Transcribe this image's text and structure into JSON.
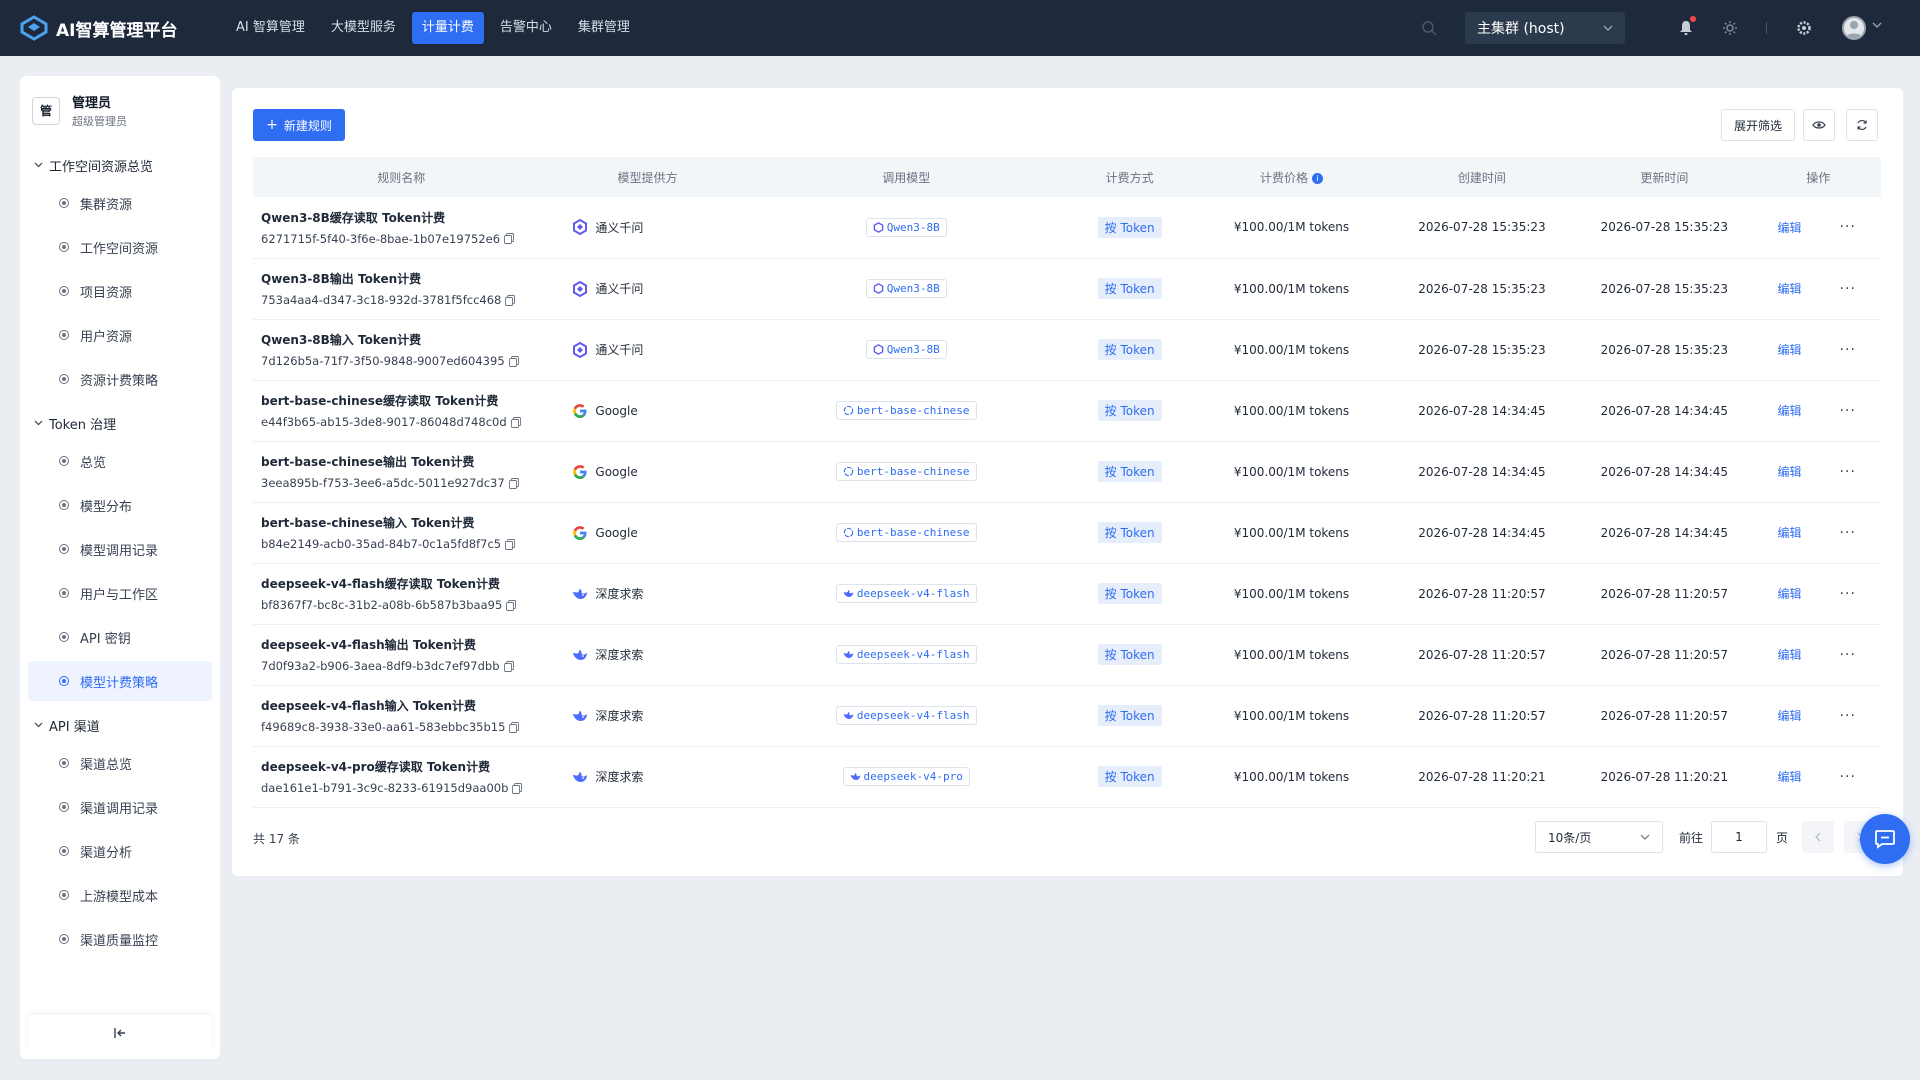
{
  "app": {
    "title": "AI智算管理平台"
  },
  "topnav": [
    {
      "label": "AI 智算管理",
      "active": false
    },
    {
      "label": "大模型服务",
      "active": false
    },
    {
      "label": "计量计费",
      "active": true
    },
    {
      "label": "告警中心",
      "active": false
    },
    {
      "label": "集群管理",
      "active": false
    }
  ],
  "cluster": {
    "selected": "主集群 (host)"
  },
  "user": {
    "avatar_char": "管",
    "name": "管理员",
    "role": "超级管理员"
  },
  "sidebar": {
    "groups": [
      {
        "label": "工作空间资源总览",
        "items": [
          {
            "label": "集群资源"
          },
          {
            "label": "工作空间资源"
          },
          {
            "label": "项目资源"
          },
          {
            "label": "用户资源"
          },
          {
            "label": "资源计费策略"
          }
        ]
      },
      {
        "label": "Token 治理",
        "items": [
          {
            "label": "总览"
          },
          {
            "label": "模型分布"
          },
          {
            "label": "模型调用记录"
          },
          {
            "label": "用户与工作区"
          },
          {
            "label": "API 密钥"
          },
          {
            "label": "模型计费策略",
            "active": true
          }
        ]
      },
      {
        "label": "API 渠道",
        "items": [
          {
            "label": "渠道总览"
          },
          {
            "label": "渠道调用记录"
          },
          {
            "label": "渠道分析"
          },
          {
            "label": "上游模型成本"
          },
          {
            "label": "渠道质量监控"
          }
        ]
      }
    ]
  },
  "toolbar": {
    "new_label": "新建规则",
    "filter_label": "展开筛选"
  },
  "table": {
    "headers": [
      "规则名称",
      "模型提供方",
      "调用模型",
      "计费方式",
      "计费价格",
      "创建时间",
      "更新时间",
      "操作"
    ],
    "edit_label": "编辑",
    "rows": [
      {
        "name": "Qwen3-8B缓存读取 Token计费",
        "id": "6271715f-5f40-3f6e-8bae-1b07e19752e6",
        "provider": "通义千问",
        "provider_icon": "qwen",
        "model": "Qwen3-8B",
        "billing": "按 Token",
        "price": "¥100.00/1M tokens",
        "created": "2026-07-28 15:35:23",
        "updated": "2026-07-28 15:35:23"
      },
      {
        "name": "Qwen3-8B输出 Token计费",
        "id": "753a4aa4-d347-3c18-932d-3781f5fcc468",
        "provider": "通义千问",
        "provider_icon": "qwen",
        "model": "Qwen3-8B",
        "billing": "按 Token",
        "price": "¥100.00/1M tokens",
        "created": "2026-07-28 15:35:23",
        "updated": "2026-07-28 15:35:23"
      },
      {
        "name": "Qwen3-8B输入 Token计费",
        "id": "7d126b5a-71f7-3f50-9848-9007ed604395",
        "provider": "通义千问",
        "provider_icon": "qwen",
        "model": "Qwen3-8B",
        "billing": "按 Token",
        "price": "¥100.00/1M tokens",
        "created": "2026-07-28 15:35:23",
        "updated": "2026-07-28 15:35:23"
      },
      {
        "name": "bert-base-chinese缓存读取 Token计费",
        "id": "e44f3b65-ab15-3de8-9017-86048d748c0d",
        "provider": "Google",
        "provider_icon": "google",
        "model": "bert-base-chinese",
        "billing": "按 Token",
        "price": "¥100.00/1M tokens",
        "created": "2026-07-28 14:34:45",
        "updated": "2026-07-28 14:34:45"
      },
      {
        "name": "bert-base-chinese输出 Token计费",
        "id": "3eea895b-f753-3ee6-a5dc-5011e927dc37",
        "provider": "Google",
        "provider_icon": "google",
        "model": "bert-base-chinese",
        "billing": "按 Token",
        "price": "¥100.00/1M tokens",
        "created": "2026-07-28 14:34:45",
        "updated": "2026-07-28 14:34:45"
      },
      {
        "name": "bert-base-chinese输入 Token计费",
        "id": "b84e2149-acb0-35ad-84b7-0c1a5fd8f7c5",
        "provider": "Google",
        "provider_icon": "google",
        "model": "bert-base-chinese",
        "billing": "按 Token",
        "price": "¥100.00/1M tokens",
        "created": "2026-07-28 14:34:45",
        "updated": "2026-07-28 14:34:45"
      },
      {
        "name": "deepseek-v4-flash缓存读取 Token计费",
        "id": "bf8367f7-bc8c-31b2-a08b-6b587b3baa95",
        "provider": "深度求索",
        "provider_icon": "deepseek",
        "model": "deepseek-v4-flash",
        "billing": "按 Token",
        "price": "¥100.00/1M tokens",
        "created": "2026-07-28 11:20:57",
        "updated": "2026-07-28 11:20:57"
      },
      {
        "name": "deepseek-v4-flash输出 Token计费",
        "id": "7d0f93a2-b906-3aea-8df9-b3dc7ef97dbb",
        "provider": "深度求索",
        "provider_icon": "deepseek",
        "model": "deepseek-v4-flash",
        "billing": "按 Token",
        "price": "¥100.00/1M tokens",
        "created": "2026-07-28 11:20:57",
        "updated": "2026-07-28 11:20:57"
      },
      {
        "name": "deepseek-v4-flash输入 Token计费",
        "id": "f49689c8-3938-33e0-aa61-583ebbc35b15",
        "provider": "深度求索",
        "provider_icon": "deepseek",
        "model": "deepseek-v4-flash",
        "billing": "按 Token",
        "price": "¥100.00/1M tokens",
        "created": "2026-07-28 11:20:57",
        "updated": "2026-07-28 11:20:57"
      },
      {
        "name": "deepseek-v4-pro缓存读取 Token计费",
        "id": "dae161e1-b791-3c9c-8233-61915d9aa00b",
        "provider": "深度求索",
        "provider_icon": "deepseek",
        "model": "deepseek-v4-pro",
        "billing": "按 Token",
        "price": "¥100.00/1M tokens",
        "created": "2026-07-28 11:20:21",
        "updated": "2026-07-28 11:20:21"
      }
    ]
  },
  "pagination": {
    "total": "共 17 条",
    "page_size": "10条/页",
    "goto_label": "前往",
    "goto_value": "1",
    "page_label": "页"
  },
  "colors": {
    "primary": "#2f6df3",
    "topbar": "#1e2a3b",
    "background": "#eaeef3"
  }
}
